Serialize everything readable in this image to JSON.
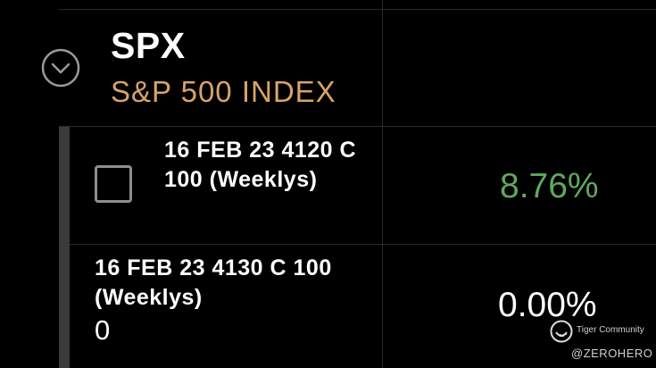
{
  "header": {
    "symbol": "SPX",
    "name": "S&P 500 INDEX"
  },
  "rows": [
    {
      "line1": "16 FEB 23 4120 C",
      "line2": "100 (Weeklys)",
      "percent": "8.76%",
      "selected": false
    },
    {
      "line1": "16 FEB 23 4130 C 100",
      "line2": "(Weeklys)",
      "quantity": "0",
      "percent": "0.00%"
    }
  ],
  "watermark": {
    "brand": "Tiger Community",
    "handle": "@ZEROHERO"
  },
  "icons": {
    "expand": "chevron-down-circle-icon",
    "checkbox": "checkbox-unchecked",
    "watermark_logo": "tiger-logo-icon"
  },
  "colors": {
    "background": "#000000",
    "index_name": "#d7a36a",
    "positive": "#5fa85d",
    "text": "#ffffff",
    "checkbox_border": "#8e8e8e"
  }
}
